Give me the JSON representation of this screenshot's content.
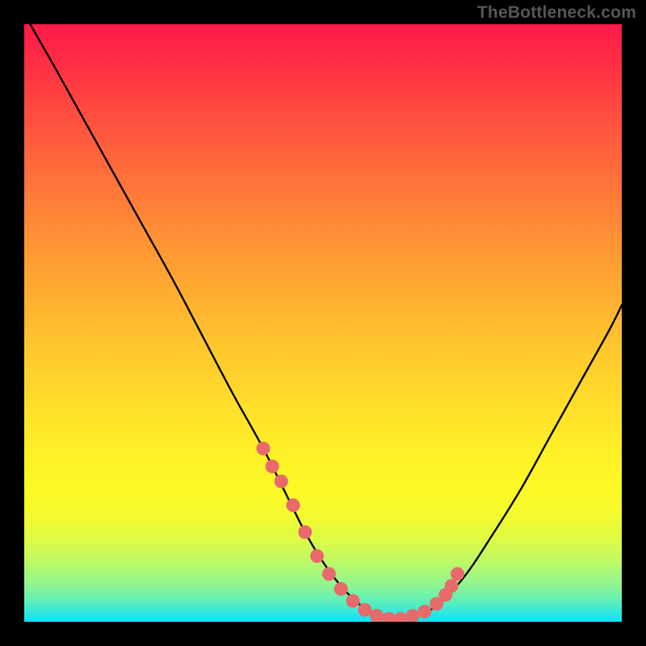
{
  "watermark": "TheBottleneck.com",
  "chart_data": {
    "type": "line",
    "title": "",
    "xlabel": "",
    "ylabel": "",
    "xlim": [
      0,
      100
    ],
    "ylim": [
      0,
      100
    ],
    "series": [
      {
        "name": "bottleneck-curve",
        "x": [
          1,
          5,
          10,
          15,
          20,
          25,
          30,
          35,
          40,
          44,
          47,
          50,
          53,
          56,
          59,
          62,
          64,
          67,
          70,
          74,
          78,
          83,
          88,
          93,
          98,
          100
        ],
        "y": [
          100,
          93,
          84,
          75,
          66,
          57,
          47.5,
          38,
          29,
          21,
          15,
          10,
          6,
          3,
          1.2,
          0.5,
          0.5,
          1.5,
          3.5,
          8,
          14,
          22,
          31,
          40,
          49,
          53
        ]
      }
    ],
    "markers": {
      "name": "highlighted-points",
      "color": "#e86a6a",
      "x": [
        40,
        41.5,
        43,
        45,
        47,
        49,
        51,
        53,
        55,
        57,
        59,
        61,
        63,
        65,
        67,
        69,
        70.5,
        71.5,
        72.5
      ],
      "y": [
        29,
        26,
        23.5,
        19.5,
        15,
        11,
        8,
        5.5,
        3.5,
        2,
        1,
        0.5,
        0.5,
        1,
        1.7,
        3,
        4.5,
        6,
        8
      ]
    }
  }
}
